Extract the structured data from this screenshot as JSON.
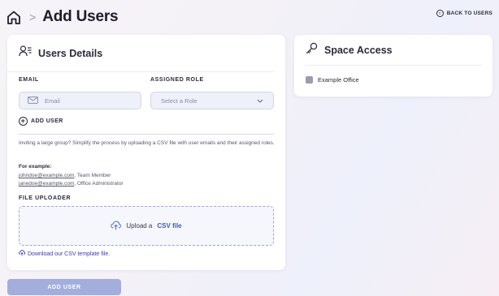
{
  "header": {
    "title": "Add Users",
    "breadcrumb_separator": ">",
    "back_label": "BACK TO USERS"
  },
  "users_details": {
    "title": "Users Details",
    "email_label": "EMAIL",
    "email_placeholder": "Email",
    "role_label": "ASSIGNED ROLE",
    "role_placeholder": "Select a Role",
    "add_user_label": "ADD USER",
    "hint": "Inviting a large group? Simplify the process by uploading a CSV file with user emails and their assigned roles.",
    "example_title": "For example:",
    "examples": [
      {
        "email": "johndoe@example.com",
        "role": ", Team Member"
      },
      {
        "email": "janedoe@example.com",
        "role": ", Office Administrator"
      }
    ],
    "uploader_label": "FILE UPLOADER",
    "upload_text": "Upload a",
    "upload_link": "CSV file",
    "download_text": "Download our CSV template file."
  },
  "space_access": {
    "title": "Space Access",
    "spaces": [
      {
        "label": "Example Office",
        "checked": false
      }
    ]
  },
  "footer": {
    "submit_label": "ADD USER"
  },
  "colors": {
    "accent": "#3a5bb8",
    "submit_button": "#a3aedd",
    "input_bg": "#eef0fa"
  }
}
